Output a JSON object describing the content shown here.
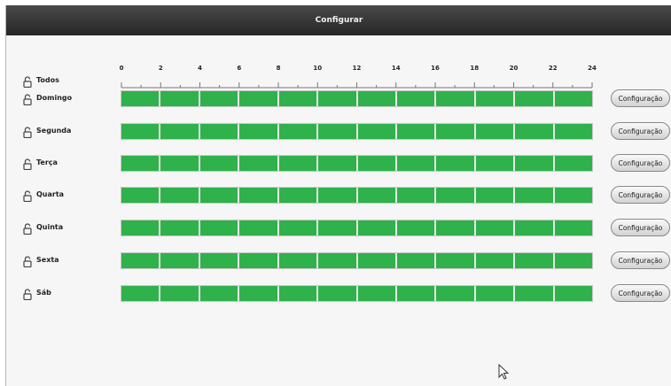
{
  "window": {
    "title": "Configurar"
  },
  "header_row": {
    "label": "Todos"
  },
  "ruler": {
    "ticks": [
      "0",
      "2",
      "4",
      "6",
      "8",
      "10",
      "12",
      "14",
      "16",
      "18",
      "20",
      "22",
      "24"
    ]
  },
  "days": [
    {
      "label": "Domingo",
      "button": "Configuração"
    },
    {
      "label": "Segunda",
      "button": "Configuração"
    },
    {
      "label": "Terça",
      "button": "Configuração"
    },
    {
      "label": "Quarta",
      "button": "Configuração"
    },
    {
      "label": "Quinta",
      "button": "Configuração"
    },
    {
      "label": "Sexta",
      "button": "Configuração"
    },
    {
      "label": "Sáb",
      "button": "Configuração"
    }
  ],
  "colors": {
    "schedule_active": "#2fb14b",
    "titlebar": "#333333"
  },
  "icons": {
    "row_lock": "lock-icon",
    "pointer": "mouse-pointer-icon"
  }
}
